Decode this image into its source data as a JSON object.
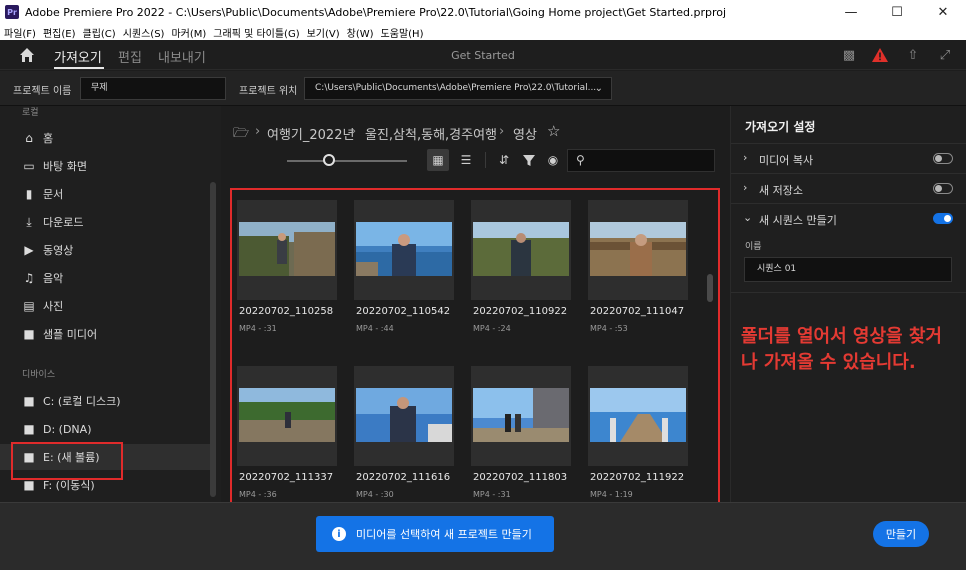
{
  "window": {
    "app_badge": "Pr",
    "title": "Adobe Premiere Pro 2022 - C:\\Users\\Public\\Documents\\Adobe\\Premiere Pro\\22.0\\Tutorial\\Going Home project\\Get Started.prproj"
  },
  "menu": [
    "파일(F)",
    "편집(E)",
    "클립(C)",
    "시퀀스(S)",
    "마커(M)",
    "그래픽 및 타이틀(G)",
    "보기(V)",
    "창(W)",
    "도움말(H)"
  ],
  "header": {
    "tabs": [
      {
        "label": "가져오기",
        "active": true
      },
      {
        "label": "편집",
        "active": false
      },
      {
        "label": "내보내기",
        "active": false
      }
    ],
    "center_title": "Get Started"
  },
  "project_bar": {
    "name_label": "프로젝트 이름",
    "name_value": "무제",
    "location_label": "프로젝트 위치",
    "location_value": "C:\\Users\\Public\\Documents\\Adobe\\Premiere Pro\\22.0\\Tutorial..."
  },
  "sidebar": {
    "local_section": "로컬",
    "local_items": [
      {
        "label": "홈",
        "icon": "home-icon"
      },
      {
        "label": "바탕 화면",
        "icon": "desktop-icon"
      },
      {
        "label": "문서",
        "icon": "document-icon"
      },
      {
        "label": "다운로드",
        "icon": "download-icon"
      },
      {
        "label": "동영상",
        "icon": "video-icon"
      },
      {
        "label": "음악",
        "icon": "music-icon"
      },
      {
        "label": "사진",
        "icon": "photo-icon"
      },
      {
        "label": "샘플 미디어",
        "icon": "folder-icon"
      }
    ],
    "device_section": "디바이스",
    "devices": [
      {
        "label": "C: (로컬 디스크)"
      },
      {
        "label": "D: (DNA)"
      },
      {
        "label": "E: (새 볼륨)",
        "selected": true
      },
      {
        "label": "F: (이동식)"
      }
    ]
  },
  "browser": {
    "breadcrumb": [
      "여행기_2022년",
      "울진,삼척,동해,경주여행",
      "영상"
    ],
    "thumb_size_level": 0.35,
    "files": [
      {
        "name": "20220702_110258",
        "meta": "MP4 - :31"
      },
      {
        "name": "20220702_110542",
        "meta": "MP4 - :44"
      },
      {
        "name": "20220702_110922",
        "meta": "MP4 - :24"
      },
      {
        "name": "20220702_111047",
        "meta": "MP4 - :53"
      },
      {
        "name": "20220702_111337",
        "meta": "MP4 - :36"
      },
      {
        "name": "20220702_111616",
        "meta": "MP4 - :30"
      },
      {
        "name": "20220702_111803",
        "meta": "MP4 - :31"
      },
      {
        "name": "20220702_111922",
        "meta": "MP4 - 1:19"
      }
    ]
  },
  "import_settings": {
    "title": "가져오기 설정",
    "rows": [
      {
        "label": "미디어 복사",
        "on": false,
        "expanded": false
      },
      {
        "label": "새 저장소",
        "on": false,
        "expanded": false
      },
      {
        "label": "새 시퀀스 만들기",
        "on": true,
        "expanded": true
      }
    ],
    "name_label": "이름",
    "name_value": "시퀀스 01",
    "annotation": "폴더를 열어서 영상을 찾거나 가져올 수 있습니다."
  },
  "footer": {
    "info_text": "미디어를 선택하여 새 프로젝트 만들기",
    "create_label": "만들기"
  },
  "colors": {
    "accent": "#1473e6",
    "highlight": "#e02b2b"
  }
}
